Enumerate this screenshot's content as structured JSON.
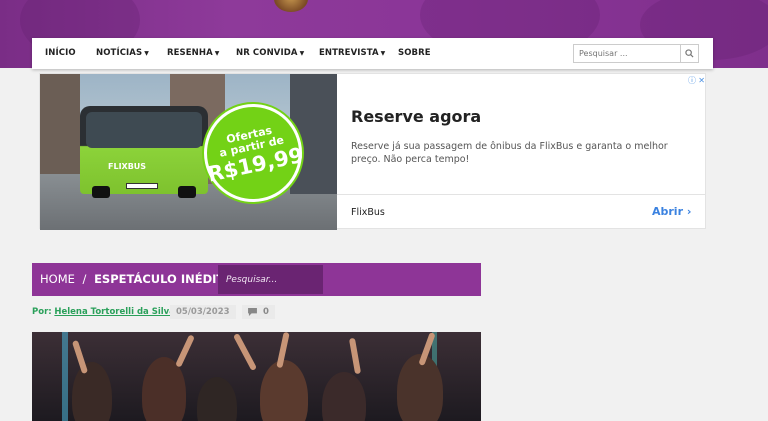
{
  "nav": {
    "items": [
      {
        "label": "INÍCIO",
        "dropdown": false
      },
      {
        "label": "NOTÍCIAS",
        "dropdown": true
      },
      {
        "label": "RESENHA",
        "dropdown": true
      },
      {
        "label": "NR CONVIDA",
        "dropdown": true
      },
      {
        "label": "ENTREVISTA",
        "dropdown": true
      },
      {
        "label": "SOBRE",
        "dropdown": false
      }
    ],
    "search_placeholder": "Pesquisar ..."
  },
  "ad": {
    "badge_lines": [
      "Ofertas",
      "a partir de"
    ],
    "price": "R$19,99",
    "bus_logo": "FLIXBUS",
    "title": "Reserve agora",
    "description": "Reserve já sua passagem de ônibus da FlixBus e garanta o melhor preço. Não perca tempo!",
    "advertiser": "FlixBus",
    "cta": "Abrir",
    "colors": {
      "brand_green": "#73d216",
      "cta_blue": "#3b82e0"
    }
  },
  "breadcrumb": {
    "home": "HOME",
    "separator": "/",
    "current": "ESPETÁCULO INÉDITO ...",
    "search_placeholder": "Pesquisar..."
  },
  "post_meta": {
    "by_label": "Por:",
    "author": "Helena Tortorelli da Silva",
    "date": "05/03/2023",
    "comments": "0"
  },
  "colors": {
    "header_purple": "#8e3597",
    "author_green": "#2aa05a"
  }
}
